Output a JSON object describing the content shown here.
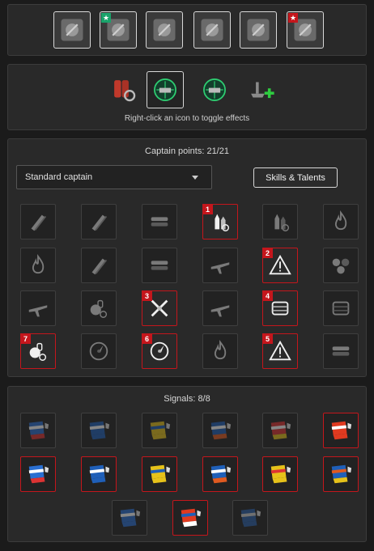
{
  "upgrades": {
    "slots": [
      {
        "icon": "main-battery-upgrade-icon",
        "starred": false
      },
      {
        "icon": "aiming-systems-upgrade-icon",
        "starred": true
      },
      {
        "icon": "propulsion-upgrade-icon",
        "starred": false
      },
      {
        "icon": "propeller-upgrade-icon",
        "starred": false
      },
      {
        "icon": "aircraft-upgrade-icon",
        "starred": false
      },
      {
        "icon": "secondary-battery-upgrade-icon",
        "starred": true
      }
    ]
  },
  "consumables": {
    "items": [
      {
        "icon": "damage-control-icon",
        "selected": false
      },
      {
        "icon": "hydroacoustic-search-icon",
        "selected": true
      },
      {
        "icon": "surveillance-radar-icon",
        "selected": false
      },
      {
        "icon": "repair-party-icon",
        "selected": false
      }
    ],
    "hint": "Right-click an icon to toggle effects"
  },
  "captain": {
    "points_label": "Captain points: 21/21",
    "selected_captain": "Standard captain",
    "skills_button": "Skills & Talents",
    "skills": [
      {
        "icon": "gun-feeder-icon",
        "on": false,
        "order": ""
      },
      {
        "icon": "grease-the-gears-icon",
        "on": false,
        "order": ""
      },
      {
        "icon": "fill-the-tubes-icon",
        "on": false,
        "order": ""
      },
      {
        "icon": "main-battery-ap-icon",
        "on": true,
        "order": "1"
      },
      {
        "icon": "inertia-fuse-icon",
        "on": false,
        "order": ""
      },
      {
        "icon": "focus-fire-icon",
        "on": false,
        "order": ""
      },
      {
        "icon": "fire-prevention-icon",
        "on": false,
        "order": ""
      },
      {
        "icon": "main-battery-reload-icon",
        "on": false,
        "order": ""
      },
      {
        "icon": "torpedo-reload-icon",
        "on": false,
        "order": ""
      },
      {
        "icon": "aircraft-icon",
        "on": false,
        "order": ""
      },
      {
        "icon": "priority-target-icon",
        "on": true,
        "order": "2"
      },
      {
        "icon": "secondary-gun-icon",
        "on": false,
        "order": ""
      },
      {
        "icon": "aa-defense-icon",
        "on": false,
        "order": ""
      },
      {
        "icon": "consumable-specialist-icon",
        "on": false,
        "order": ""
      },
      {
        "icon": "adrenaline-rush-icon",
        "on": true,
        "order": "3"
      },
      {
        "icon": "manual-aa-icon",
        "on": false,
        "order": ""
      },
      {
        "icon": "survivability-expert-icon",
        "on": true,
        "order": "4"
      },
      {
        "icon": "ship-hull-icon",
        "on": false,
        "order": ""
      },
      {
        "icon": "emergency-repair-icon",
        "on": true,
        "order": "7"
      },
      {
        "icon": "concealment-icon",
        "on": false,
        "order": ""
      },
      {
        "icon": "radio-location-icon",
        "on": true,
        "order": "6"
      },
      {
        "icon": "aa-fire-icon",
        "on": false,
        "order": ""
      },
      {
        "icon": "incoming-fire-alert-icon",
        "on": true,
        "order": "5"
      },
      {
        "icon": "torpedo-armament-icon",
        "on": false,
        "order": ""
      }
    ]
  },
  "signals": {
    "label": "Signals: 8/8",
    "flags": [
      {
        "icon": "flag-checkered-blue-icon",
        "on": false
      },
      {
        "icon": "flag-blue-saltire-icon",
        "on": false
      },
      {
        "icon": "flag-yellow-blue-icon",
        "on": false
      },
      {
        "icon": "flag-blue-stripes-icon",
        "on": false
      },
      {
        "icon": "flag-red-diagonal-icon",
        "on": false
      },
      {
        "icon": "flag-red-white-icon",
        "on": true
      },
      {
        "icon": "flag-checkered-blue-icon",
        "on": true
      },
      {
        "icon": "flag-blue-saltire-icon",
        "on": true
      },
      {
        "icon": "flag-yellow-blue-icon",
        "on": true
      },
      {
        "icon": "flag-blue-stripes-icon",
        "on": true
      },
      {
        "icon": "flag-yellow-red-icon",
        "on": true
      },
      {
        "icon": "flag-blue-red-icon",
        "on": true
      },
      {
        "icon": "flag-blue-white-icon",
        "on": false
      },
      {
        "icon": "flag-red-blue-icon",
        "on": true
      },
      {
        "icon": "flag-blue-grey-icon",
        "on": false
      }
    ]
  },
  "colors": {
    "accent_red": "#c4161c",
    "panel": "#292929",
    "background": "#1b1b1b"
  }
}
